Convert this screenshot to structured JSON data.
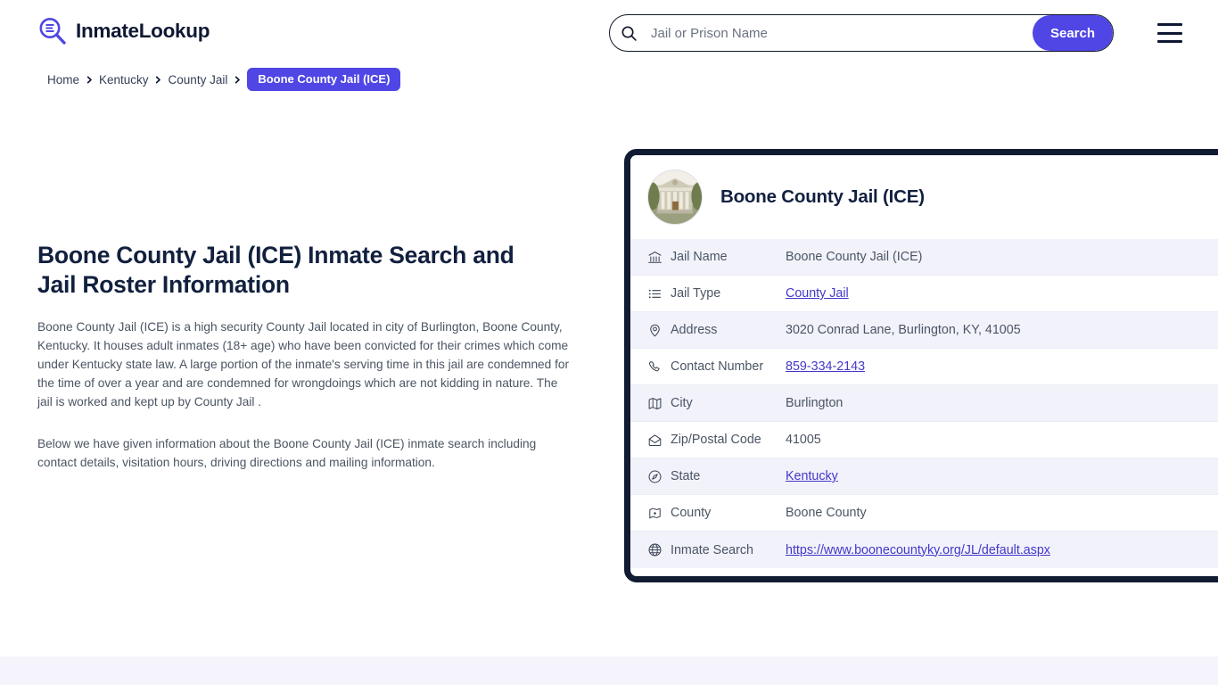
{
  "brand": {
    "name": "InmateLookup",
    "icon": "search-logo-icon",
    "accent_color": "#4f46e5"
  },
  "search": {
    "placeholder": "Jail or Prison Name",
    "value": "",
    "button_label": "Search",
    "icon": "search-icon"
  },
  "menu": {
    "icon": "hamburger-menu-icon"
  },
  "breadcrumb": {
    "items": [
      {
        "label": "Home",
        "current": false
      },
      {
        "label": "Kentucky",
        "current": false
      },
      {
        "label": "County Jail",
        "current": false
      },
      {
        "label": "Boone County Jail (ICE)",
        "current": true
      }
    ],
    "separator_icon": "chevron-right-icon"
  },
  "main": {
    "title": "Boone County Jail (ICE) Inmate Search and Jail Roster Information",
    "paragraph_1": "Boone County Jail (ICE) is a high security County Jail located in city of Burlington, Boone County, Kentucky. It houses adult inmates (18+ age) who have been convicted for their crimes which come under Kentucky state law. A large portion of the inmate's serving time in this jail are condemned for the time of over a year and are condemned for wrongdoings which are not kidding in nature. The jail is worked and kept up by County Jail .",
    "paragraph_2": "Below we have given information about the Boone County Jail (ICE) inmate search including contact details, visitation hours, driving directions and mailing information."
  },
  "card": {
    "title": "Boone County Jail (ICE)",
    "avatar_icon": "courthouse-photo",
    "border_color": "#111c33",
    "stripe_color": "#f2f2fb",
    "rows": [
      {
        "icon": "bank-building-icon",
        "label": "Jail Name",
        "value": "Boone County Jail (ICE)",
        "link": false
      },
      {
        "icon": "list-icon",
        "label": "Jail Type",
        "value": "County Jail",
        "link": true
      },
      {
        "icon": "map-pin-icon",
        "label": "Address",
        "value": "3020 Conrad Lane, Burlington, KY, 41005",
        "link": false
      },
      {
        "icon": "phone-icon",
        "label": "Contact Number",
        "value": "859-334-2143",
        "link": true
      },
      {
        "icon": "map-icon",
        "label": "City",
        "value": "Burlington",
        "link": false
      },
      {
        "icon": "envelope-open-icon",
        "label": "Zip/Postal Code",
        "value": "41005",
        "link": false
      },
      {
        "icon": "compass-icon",
        "label": "State",
        "value": "Kentucky",
        "link": true
      },
      {
        "icon": "county-marker-icon",
        "label": "County",
        "value": "Boone County",
        "link": false
      },
      {
        "icon": "globe-icon",
        "label": "Inmate Search",
        "value": "https://www.boonecountyky.org/JL/default.aspx",
        "link": true
      }
    ]
  }
}
